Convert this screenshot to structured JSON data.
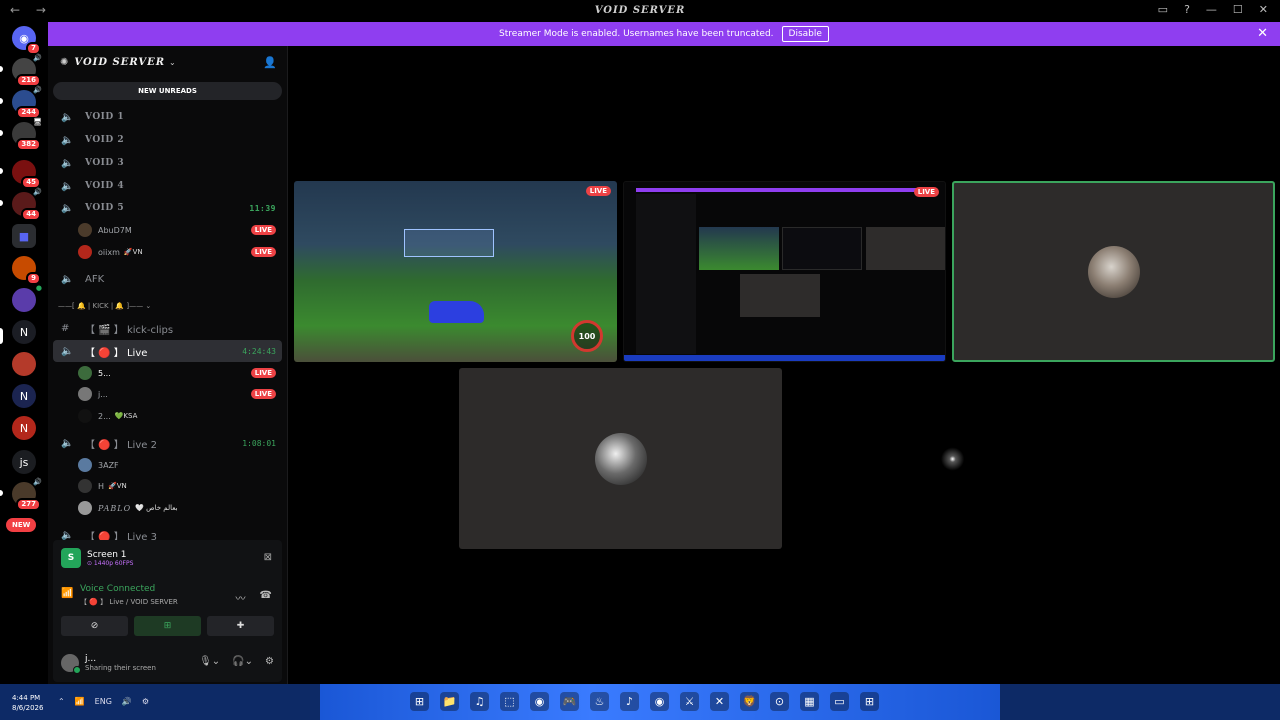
{
  "titlebar": {
    "title": "VOID SERVER",
    "nav": "← →",
    "window_buttons": [
      "▭",
      "?",
      "—",
      "☐",
      "✕"
    ]
  },
  "banner": {
    "text": "Streamer Mode is enabled. Usernames have been truncated.",
    "button": "Disable",
    "close": "✕"
  },
  "servers": {
    "items": [
      {
        "label": "◉",
        "badge": "7",
        "color": "#5865f2"
      },
      {
        "label": "",
        "badge": "216",
        "speaker": "🔊",
        "color": "#444"
      },
      {
        "label": "",
        "badge": "244",
        "speaker": "🔊",
        "color": "#2b4c8f"
      },
      {
        "label": "",
        "badge": "382",
        "speaker": "🖥",
        "color": "#3a3a3a"
      },
      {
        "label": "",
        "badge": "45",
        "color": "#7a1010"
      },
      {
        "label": "",
        "badge": "44",
        "speaker": "🔊",
        "color": "#5a1a1a"
      },
      {
        "label": "■",
        "badge": "",
        "color": "#2b2d31"
      },
      {
        "label": "",
        "badge": "9",
        "color": "#c74b00"
      },
      {
        "label": "",
        "badge": "",
        "speaker": "●",
        "color": "#5a3caa"
      },
      {
        "label": "N",
        "badge": "",
        "color": "#1b1d24"
      },
      {
        "label": "",
        "badge": "",
        "color": "#b43a2a"
      },
      {
        "label": "N",
        "badge": "",
        "color": "#1b2450"
      },
      {
        "label": "N",
        "badge": "",
        "color": "#b3271b"
      },
      {
        "label": "js",
        "badge": "",
        "color": "#1b1d21"
      },
      {
        "label": "",
        "badge": "277",
        "speaker": "🔊",
        "color": "#4a3a2a"
      }
    ],
    "new_label": "NEW"
  },
  "sidebar": {
    "server_name": "VOID SERVER",
    "new_unreads": "NEW UNREADS",
    "channels": [
      {
        "name": "VOID 1",
        "time": ""
      },
      {
        "name": "VOID 2",
        "time": ""
      },
      {
        "name": "VOID 3",
        "time": ""
      },
      {
        "name": "VOID 4",
        "time": ""
      },
      {
        "name": "VOID 5",
        "time": "11:39"
      }
    ],
    "void5_users": [
      {
        "name": "AbuD7M",
        "tag": "",
        "live": "LIVE"
      },
      {
        "name": "oiixm",
        "tag": "🚀VN",
        "live": "LIVE"
      }
    ],
    "afk": "AFK",
    "category": "——[ 🔔 | KICK | 🔔 ]—— ⌄",
    "kick_clips": "【 🎬 】 kick-clips",
    "live": {
      "name": "【 🔴 】 Live",
      "time": "4:24:43"
    },
    "live_users": [
      {
        "name": "5...",
        "tag": "",
        "live": "LIVE"
      },
      {
        "name": "j...",
        "tag": "",
        "live": "LIVE"
      },
      {
        "name": "2...",
        "tag": "💚KSA",
        "live": ""
      }
    ],
    "live2": {
      "name": "【 🔴 】 Live 2",
      "time": "1:08:01"
    },
    "live2_users": [
      {
        "name": "3AZF",
        "tag": ""
      },
      {
        "name": "H",
        "tag": "🚀VN"
      },
      {
        "name": "PABLO",
        "tag": "🤍 بعالم خاص"
      }
    ],
    "live3": {
      "name": "【 🔴 】 Live 3"
    }
  },
  "stream_panel": {
    "source": "Screen 1",
    "resolution": "⊙ 1440p 60FPS",
    "voice_status": "Voice Connected",
    "voice_channel": "【 🔴 】 Live / VOID SERVER",
    "user_name": "j...",
    "user_status": "Sharing their screen",
    "buttons": [
      "⊘",
      "⊞",
      "✚"
    ]
  },
  "stage": {
    "live_badge": "LIVE",
    "boost": "100"
  },
  "taskbar": {
    "time": "4:44 PM",
    "date": "8/6/2026",
    "lang": "ENG",
    "tray": [
      "⌃",
      "📶",
      "ENG",
      "🔊",
      "⚙"
    ],
    "apps": [
      "⊞",
      "📁",
      "♫",
      "⬚",
      "◉",
      "🎮",
      "♨",
      "♪",
      "◉",
      "⚔",
      "✕",
      "🦁",
      "⊙",
      "▦",
      "▭",
      "⊞"
    ]
  }
}
